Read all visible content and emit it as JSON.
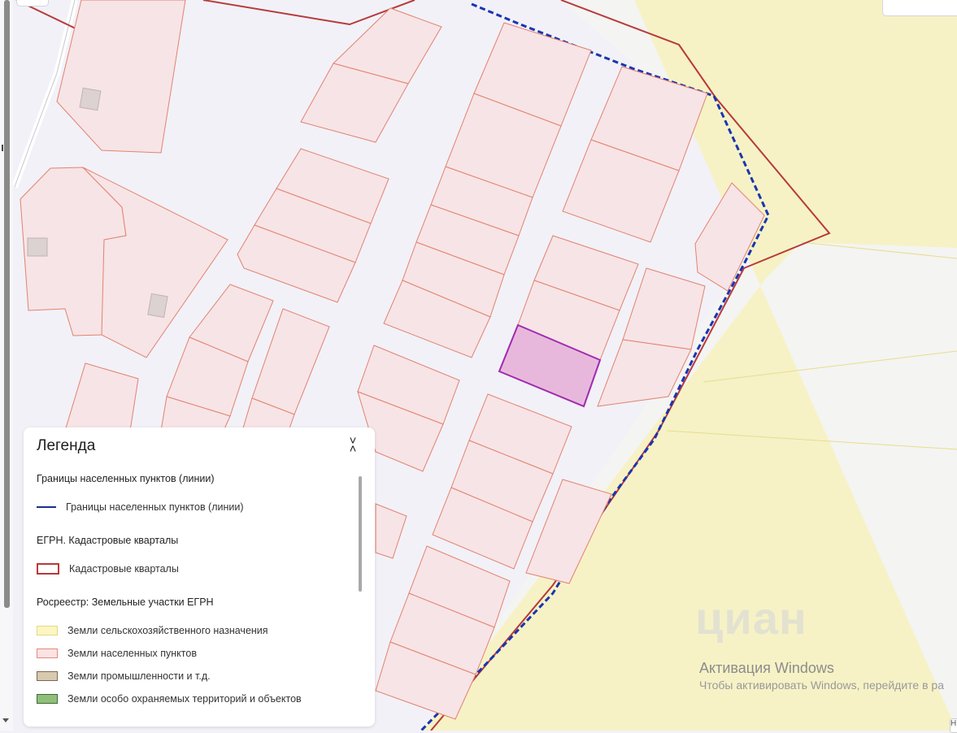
{
  "legend": {
    "title": "Легенда",
    "close_icon": "chevrons-collapse-icon",
    "sections": [
      {
        "title": "Границы населенных пунктов (линии)",
        "items": [
          {
            "label": "Границы населенных пунктов (линии)",
            "kind": "line",
            "color": "#1a2f8f"
          }
        ]
      },
      {
        "title": "ЕГРН. Кадастровые кварталы",
        "items": [
          {
            "label": "Кадастровые кварталы",
            "kind": "outline",
            "color": "#b83a3a"
          }
        ]
      },
      {
        "title": "Росреестр: Земельные участки ЕГРН",
        "items": [
          {
            "label": "Земли сельскохозяйственного назначения",
            "kind": "fill",
            "color": "#fbf6c2",
            "border": "#e4d98a"
          },
          {
            "label": "Земли населенных пунктов",
            "kind": "fill",
            "color": "#fbe3e3",
            "border": "#e58a7d"
          },
          {
            "label": "Земли промышленности и т.д.",
            "kind": "fill",
            "color": "#d8c9b0",
            "border": "#7a6a52"
          },
          {
            "label": "Земли особо охраняемых территорий и объектов",
            "kind": "fill",
            "color": "#8fbf7a",
            "border": "#3f6b33"
          }
        ]
      }
    ]
  },
  "watermark": {
    "logo": "циан",
    "title": "Активация Windows",
    "subtitle": "Чтобы активировать Windows, перейдите в ра"
  },
  "corner_chip": "Н"
}
